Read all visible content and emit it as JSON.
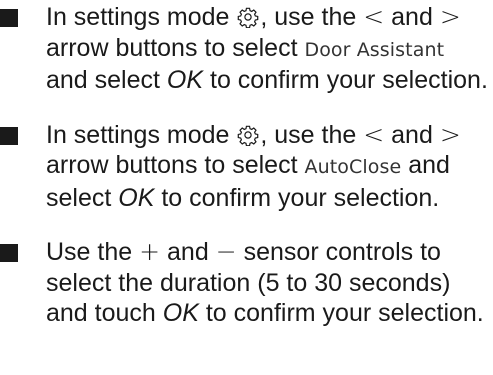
{
  "steps": [
    {
      "part1": "In settings mode",
      "icon": "gear-icon",
      "part2": ", use the",
      "less_than": "<",
      "and": "and",
      "greater_than": ">",
      "part3": "arrow buttons to select",
      "display_option": "Door Assistant",
      "part4": "and select",
      "ok": "OK",
      "part5": "to confirm your selection."
    },
    {
      "part1": "In settings mode",
      "icon": "gear-icon",
      "part2": ", use the",
      "less_than": "<",
      "and": "and",
      "greater_than": ">",
      "part3": "arrow buttons to select",
      "display_option": "AutoClose",
      "part4": "and select",
      "ok": "OK",
      "part5": "to confirm your selection."
    },
    {
      "part1": "Use the",
      "plus": "+",
      "and": "and",
      "minus": "−",
      "part2": "sensor controls to select the duration (5 to 30 seconds) and touch",
      "ok": "OK",
      "part3": "to confirm your selection."
    }
  ]
}
